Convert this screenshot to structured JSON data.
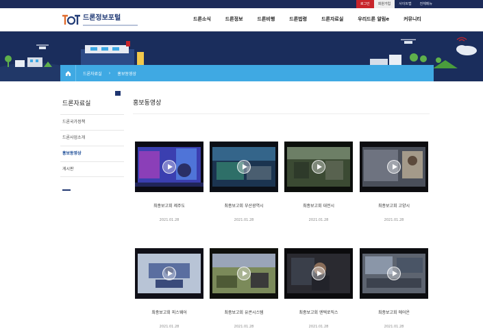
{
  "util_bar": {
    "login": "로그인",
    "join": "회원가입",
    "sitemap": "사이트맵",
    "all_menu": "전체메뉴"
  },
  "logo": {
    "text": "드론정보포털"
  },
  "gnb": [
    "드론소식",
    "드론정보",
    "드론비행",
    "드론법령",
    "드론자료실",
    "우리드론 알림e",
    "커뮤니티"
  ],
  "breadcrumb": {
    "home_icon": "home-icon",
    "items": [
      "드론자료실",
      "홍보동영상"
    ]
  },
  "sidebar": {
    "title": "드론자료실",
    "items": [
      {
        "label": "드론국가정책",
        "active": false
      },
      {
        "label": "드론사업소개",
        "active": false
      },
      {
        "label": "홍보동영상",
        "active": true
      },
      {
        "label": "게시판",
        "active": false
      }
    ]
  },
  "main": {
    "title": "홍보동영상",
    "videos": [
      {
        "title": "최종보고회 제주도",
        "date": "2021.01.28"
      },
      {
        "title": "최종보고회 부산광역시",
        "date": "2021.01.28"
      },
      {
        "title": "최종보고회 대전시",
        "date": "2021.01.28"
      },
      {
        "title": "최종보고회 고양시",
        "date": "2021.01.28"
      },
      {
        "title": "최종보고회 피스웨어",
        "date": "2021.01.28"
      },
      {
        "title": "최종보고회 유콘시스템",
        "date": "2021.01.28"
      },
      {
        "title": "최종보고회 엔텍로직스",
        "date": "2021.01.28"
      },
      {
        "title": "최종보고회 에어온",
        "date": "2021.01.28"
      }
    ]
  },
  "colors": {
    "navy": "#1c2b59",
    "banner": "#1a2d5c",
    "breadcrumb": "#3fa9e3",
    "login_red": "#c8242a",
    "active_menu": "#1a4b96"
  }
}
